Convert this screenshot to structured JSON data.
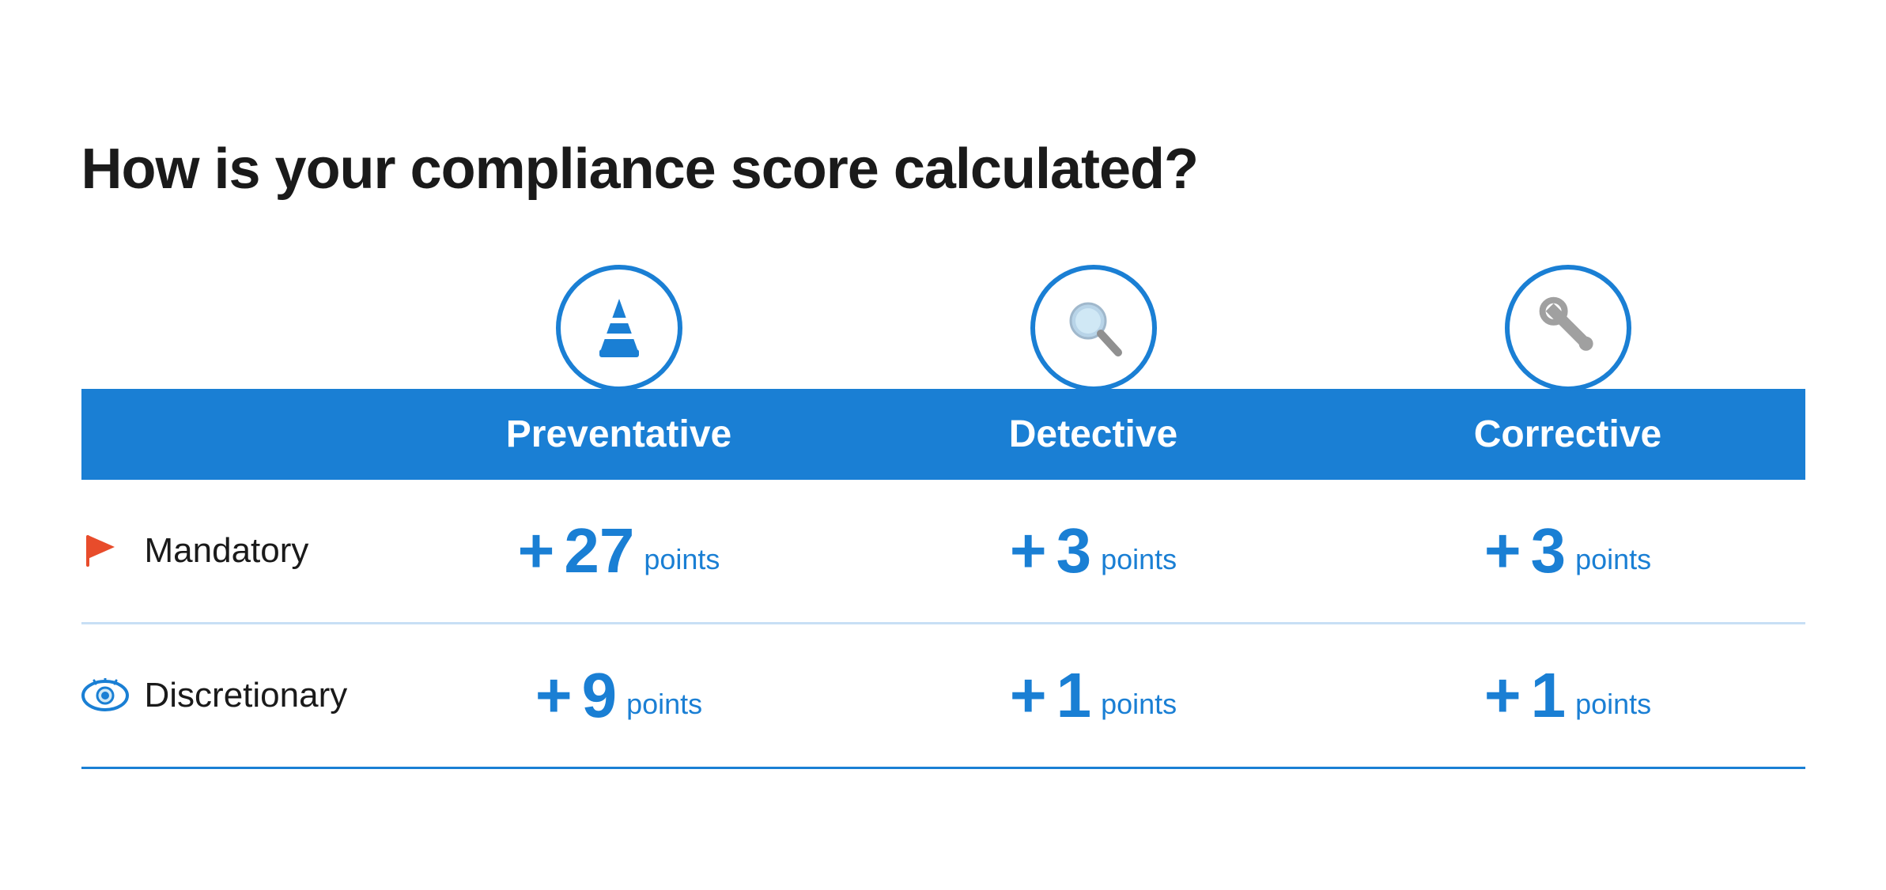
{
  "title": "How is your compliance score calculated?",
  "colors": {
    "blue": "#1a7fd4",
    "dark": "#1a1a1a",
    "white": "#ffffff",
    "lightBlue": "#c8dff5"
  },
  "categories": [
    {
      "id": "preventative",
      "label": "Preventative",
      "icon": "cone-icon"
    },
    {
      "id": "detective",
      "label": "Detective",
      "icon": "magnifier-icon"
    },
    {
      "id": "corrective",
      "label": "Corrective",
      "icon": "wrench-icon"
    }
  ],
  "rows": [
    {
      "id": "mandatory",
      "label": "Mandatory",
      "icon": "flag-icon",
      "values": [
        {
          "prefix": "+",
          "number": "27",
          "suffix": "points"
        },
        {
          "prefix": "+",
          "number": "3",
          "suffix": "points"
        },
        {
          "prefix": "+",
          "number": "3",
          "suffix": "points"
        }
      ]
    },
    {
      "id": "discretionary",
      "label": "Discretionary",
      "icon": "eye-icon",
      "values": [
        {
          "prefix": "+",
          "number": "9",
          "suffix": "points"
        },
        {
          "prefix": "+",
          "number": "1",
          "suffix": "points"
        },
        {
          "prefix": "+",
          "number": "1",
          "suffix": "points"
        }
      ]
    }
  ]
}
